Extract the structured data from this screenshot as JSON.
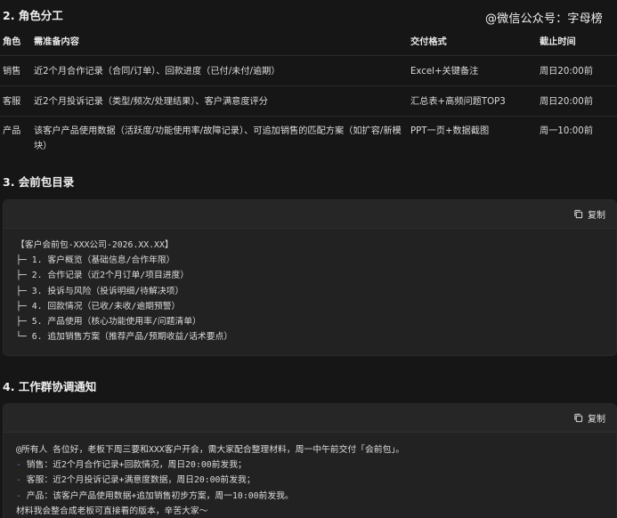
{
  "watermark": "@微信公众号：字母榜",
  "sections": {
    "roles_title": "2. 角色分工",
    "toc_title": "3. 会前包目录",
    "notice_title": "4. 工作群协调通知"
  },
  "roles_table": {
    "headers": [
      "角色",
      "需准备内容",
      "交付格式",
      "截止时间"
    ],
    "rows": [
      {
        "role": "销售",
        "content": "近2个月合作记录（合同/订单）、回款进度（已付/未付/逾期）",
        "format": "Excel+关键备注",
        "deadline": "周日20:00前"
      },
      {
        "role": "客服",
        "content": "近2个月投诉记录（类型/频次/处理结果）、客户满意度评分",
        "format": "汇总表+高频问题TOP3",
        "deadline": "周日20:00前"
      },
      {
        "role": "产品",
        "content": "该客户产品使用数据（活跃度/功能使用率/故障记录）、可追加销售的匹配方案（如扩容/新模块）",
        "format": "PPT一页+数据截图",
        "deadline": "周一10:00前"
      }
    ]
  },
  "copy_label": "复制",
  "toc_block": {
    "lines": [
      "【客户会前包-XXX公司-2026.XX.XX】",
      "├─ 1. 客户概览（基础信息/合作年限）",
      "├─ 2. 合作记录（近2个月订单/项目进度）",
      "├─ 3. 投诉与风险（投诉明细/待解决项）",
      "├─ 4. 回款情况（已收/未收/逾期预警）",
      "├─ 5. 产品使用（核心功能使用率/问题清单）",
      "└─ 6. 追加销售方案（推荐产品/预期收益/话术要点）"
    ]
  },
  "notice_block": {
    "intro": "@所有人 各位好，老板下周三要和XXX客户开会，需大家配合整理材料，周一中午前交付「会前包」。",
    "items": [
      {
        "dash": "-",
        "text": " 销售：近2个月合作记录+回款情况，周日20:00前发我；"
      },
      {
        "dash": "-",
        "text": " 客服：近2个月投诉记录+满意度数据，周日20:00前发我；"
      },
      {
        "dash": "-",
        "text": " 产品：该客户产品使用数据+追加销售初步方案，周一10:00前发我。"
      }
    ],
    "outro": "材料我会整合成老板可直接看的版本，辛苦大家～"
  }
}
